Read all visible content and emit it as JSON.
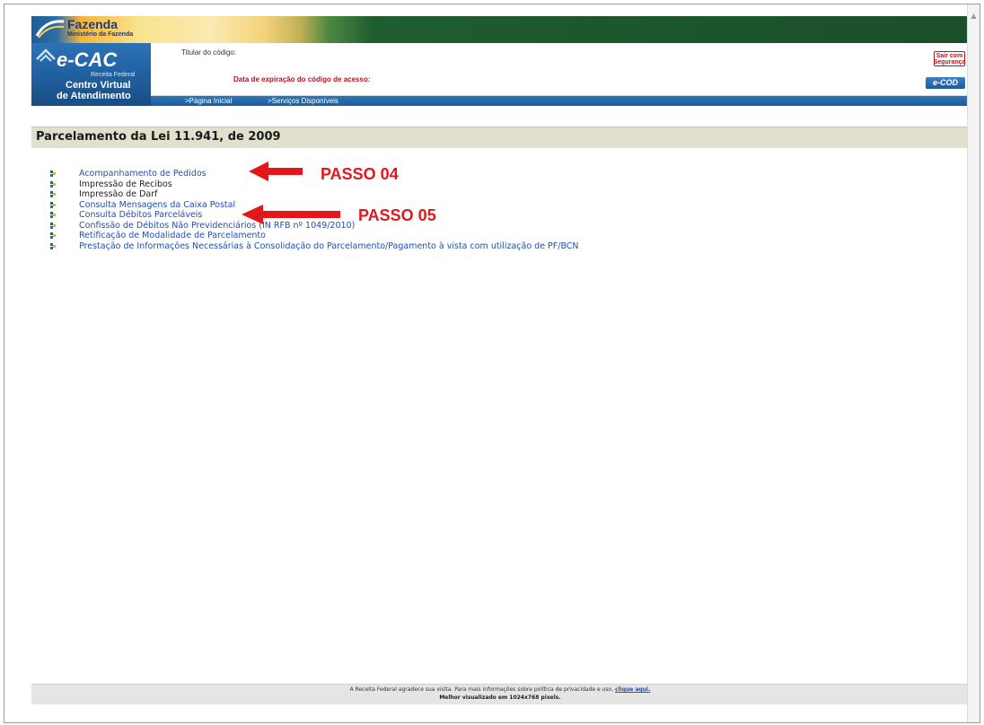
{
  "header": {
    "ministry_title": "Fazenda",
    "ministry_subtitle": "Ministério da Fazenda",
    "logo_title": "e-CAC",
    "logo_org": "Receita Federal",
    "logo_line1": "Centro Virtual",
    "logo_line2": "de Atendimento",
    "titular_label": "Titular do código:",
    "expiracao_label": "Data de expiração do código de acesso:",
    "sair_button": "Sair com Segurança",
    "ecod_button": "e-COD",
    "nav": [
      {
        "label": ">Página Inicial"
      },
      {
        "label": ">Serviços Disponíveis"
      }
    ]
  },
  "section": {
    "title": "Parcelamento da Lei 11.941, de 2009"
  },
  "menu": {
    "items": [
      {
        "label": "Acompanhamento de Pedidos",
        "link": true
      },
      {
        "label": "Impressão de Recibos",
        "link": false
      },
      {
        "label": "Impressão de Darf",
        "link": false
      },
      {
        "label": "Consulta Mensagens da Caixa Postal",
        "link": true
      },
      {
        "label": "Consulta Débitos Parceláveis",
        "link": true
      },
      {
        "label": "Confissão de Débitos Não Previdenciários (IN RFB nº 1049/2010)",
        "link": true
      },
      {
        "label": "Retificação de Modalidade de Parcelamento",
        "link": true
      },
      {
        "label": "Prestação de Informações Necessárias à Consolidação do Parcelamento/Pagamento à vista com utilização de PF/BCN",
        "link": true
      }
    ]
  },
  "annotations": {
    "passo_04": "PASSO 04",
    "passo_05": "PASSO 05",
    "color": "#e3171a"
  },
  "footer": {
    "line1_text": "A Receita Federal agradece sua visita. Para mais informações sobre política de privacidade e uso,",
    "line1_link": "clique aqui.",
    "line2": "Melhor visualizado em 1024x768 pixels."
  },
  "colors": {
    "link": "#1f4fb3",
    "section_bar": "#e1e0cd",
    "brand_blue": "#1f5d9b",
    "alert_red": "#c0101a"
  }
}
